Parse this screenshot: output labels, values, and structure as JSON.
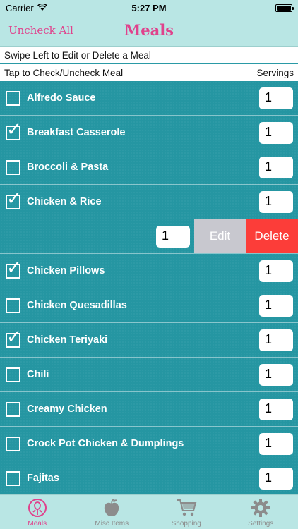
{
  "status_bar": {
    "carrier": "Carrier",
    "time": "5:27 PM",
    "battery_level": 1.0
  },
  "nav": {
    "left_button": "Uncheck All",
    "title": "Meals"
  },
  "hints": {
    "swipe": "Swipe Left to Edit or Delete a Meal",
    "tap": "Tap to Check/Uncheck Meal",
    "servings_header": "Servings"
  },
  "meals": [
    {
      "name": "Alfredo Sauce",
      "checked": false,
      "servings": "1"
    },
    {
      "name": "Breakfast Casserole",
      "checked": true,
      "servings": "1"
    },
    {
      "name": "Broccoli & Pasta",
      "checked": false,
      "servings": "1"
    },
    {
      "name": "Chicken & Rice",
      "checked": true,
      "servings": "1"
    },
    {
      "swiped": true,
      "servings": "1",
      "edit_label": "Edit",
      "delete_label": "Delete"
    },
    {
      "name": "Chicken Pillows",
      "checked": true,
      "servings": "1"
    },
    {
      "name": "Chicken Quesadillas",
      "checked": false,
      "servings": "1"
    },
    {
      "name": "Chicken Teriyaki",
      "checked": true,
      "servings": "1"
    },
    {
      "name": "Chili",
      "checked": false,
      "servings": "1"
    },
    {
      "name": "Creamy Chicken",
      "checked": false,
      "servings": "1"
    },
    {
      "name": "Crock Pot Chicken & Dumplings",
      "checked": false,
      "servings": "1"
    },
    {
      "name": "Fajitas",
      "checked": false,
      "servings": "1"
    }
  ],
  "tabs": [
    {
      "label": "Meals",
      "icon": "meals-icon",
      "active": true
    },
    {
      "label": "Misc Items",
      "icon": "apple-icon",
      "active": false
    },
    {
      "label": "Shopping",
      "icon": "cart-icon",
      "active": false
    },
    {
      "label": "Settings",
      "icon": "gear-icon",
      "active": false
    }
  ],
  "colors": {
    "accent": "#e0428c",
    "list_bg": "#2596a2",
    "bar_bg": "#b9e6e4",
    "delete": "#fc3d39",
    "edit": "#c8c8cf"
  }
}
